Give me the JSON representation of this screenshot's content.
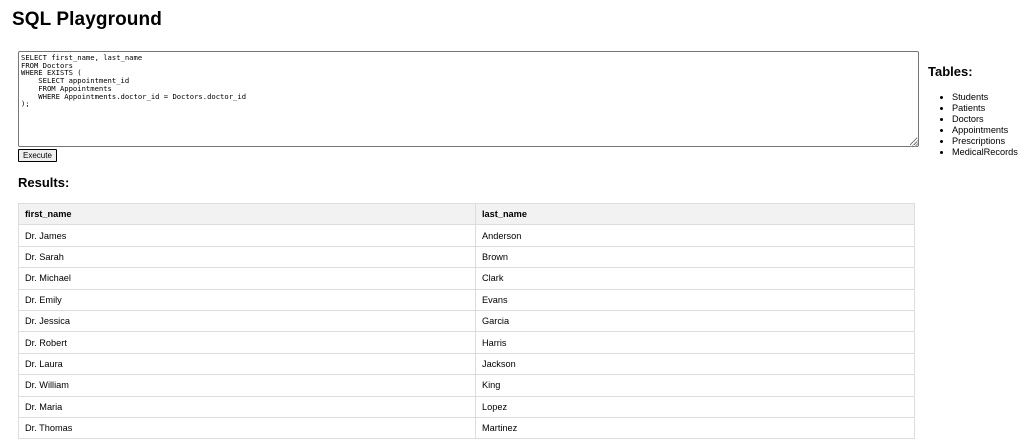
{
  "page": {
    "title": "SQL Playground"
  },
  "editor": {
    "query": "SELECT first_name, last_name\nFROM Doctors\nWHERE EXISTS (\n    SELECT appointment_id\n    FROM Appointments\n    WHERE Appointments.doctor_id = Doctors.doctor_id\n);"
  },
  "execute_button": {
    "label": "Execute"
  },
  "results": {
    "heading": "Results:",
    "columns": [
      "first_name",
      "last_name"
    ],
    "rows": [
      [
        "Dr. James",
        "Anderson"
      ],
      [
        "Dr. Sarah",
        "Brown"
      ],
      [
        "Dr. Michael",
        "Clark"
      ],
      [
        "Dr. Emily",
        "Evans"
      ],
      [
        "Dr. Jessica",
        "Garcia"
      ],
      [
        "Dr. Robert",
        "Harris"
      ],
      [
        "Dr. Laura",
        "Jackson"
      ],
      [
        "Dr. William",
        "King"
      ],
      [
        "Dr. Maria",
        "Lopez"
      ],
      [
        "Dr. Thomas",
        "Martinez"
      ]
    ]
  },
  "tables_panel": {
    "heading": "Tables:",
    "items": [
      "Students",
      "Patients",
      "Doctors",
      "Appointments",
      "Prescriptions",
      "MedicalRecords"
    ]
  }
}
